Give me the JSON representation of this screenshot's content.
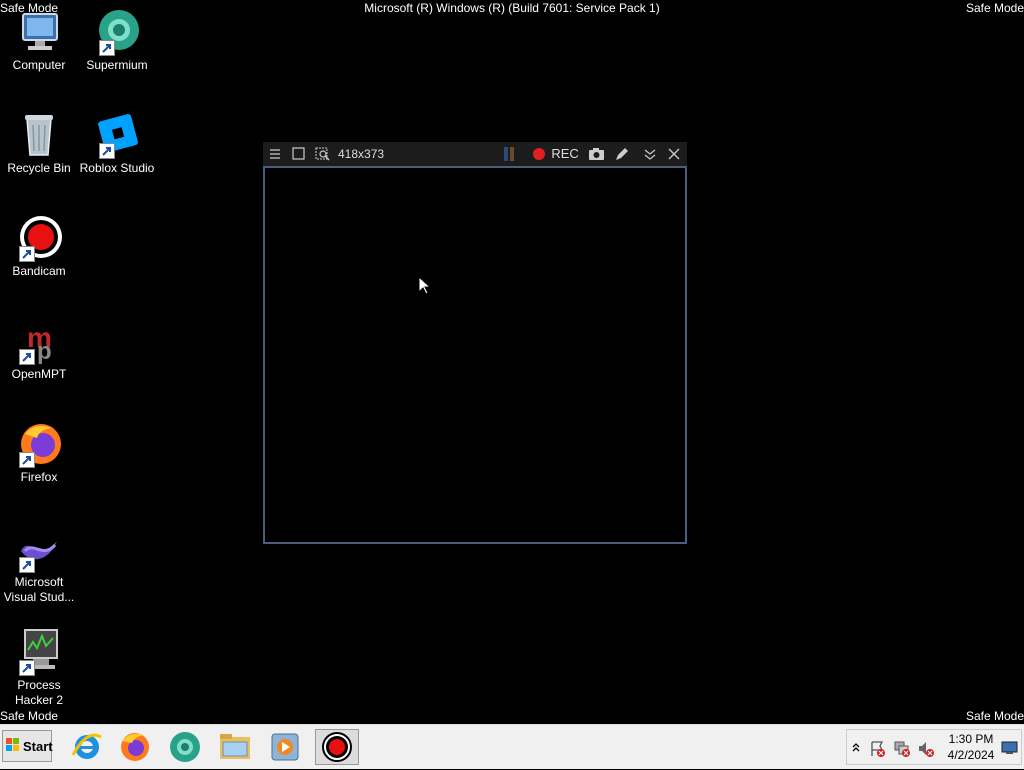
{
  "safe_mode_label": "Safe Mode",
  "os_build": "Microsoft (R) Windows (R) (Build 7601: Service Pack 1)",
  "desktop_icons": [
    {
      "label": "Computer"
    },
    {
      "label": "Supermium"
    },
    {
      "label": "Recycle Bin"
    },
    {
      "label": "Roblox Studio"
    },
    {
      "label": "Bandicam"
    },
    {
      "label": "OpenMPT"
    },
    {
      "label": "Firefox"
    },
    {
      "label": "Microsoft Visual Stud..."
    },
    {
      "label": "Process Hacker 2"
    }
  ],
  "capture_window": {
    "size_label": "418x373",
    "rec_label": "REC"
  },
  "taskbar": {
    "start_label": "Start",
    "pinned": [
      "internet-explorer-icon",
      "firefox-icon",
      "supermium-icon",
      "explorer-icon",
      "media-player-icon",
      "bandicam-icon"
    ]
  },
  "clock": {
    "time": "1:30 PM",
    "date": "4/2/2024"
  },
  "colors": {
    "desktop": "#000000",
    "capture_border": "#4a5f7e",
    "rec_red": "#e02020",
    "taskbar": "#f0f0f0"
  }
}
